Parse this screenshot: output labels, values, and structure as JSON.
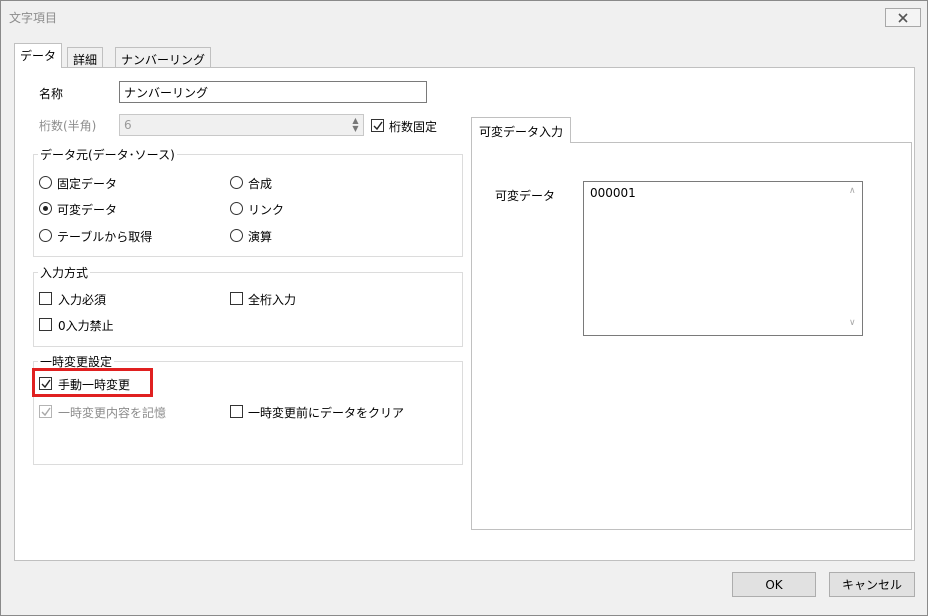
{
  "window": {
    "title": "文字項目"
  },
  "tabs": [
    {
      "label": "データ",
      "active": true
    },
    {
      "label": "詳細",
      "active": false
    },
    {
      "label": "ナンバーリング",
      "active": false
    }
  ],
  "fields": {
    "name_label": "名称",
    "name_value": "ナンバーリング",
    "digits_label": "桁数(半角)",
    "digits_value": "6",
    "fixed_digits_label": "桁数固定",
    "fixed_digits_checked": true
  },
  "data_source": {
    "title": "データ元(データ･ソース)",
    "options": [
      {
        "label": "固定データ",
        "selected": false
      },
      {
        "label": "合成",
        "selected": false
      },
      {
        "label": "可変データ",
        "selected": true
      },
      {
        "label": "リンク",
        "selected": false
      },
      {
        "label": "テーブルから取得",
        "selected": false
      },
      {
        "label": "演算",
        "selected": false
      }
    ]
  },
  "input_method": {
    "title": "入力方式",
    "options": [
      {
        "label": "入力必須",
        "checked": false
      },
      {
        "label": "全桁入力",
        "checked": false
      },
      {
        "label": "0入力禁止",
        "checked": false
      }
    ]
  },
  "temp_change": {
    "title": "一時変更設定",
    "options": [
      {
        "label": "手動一時変更",
        "checked": true,
        "enabled": true
      },
      {
        "label": "一時変更内容を記憶",
        "checked": true,
        "enabled": false
      },
      {
        "label": "一時変更前にデータをクリア",
        "checked": false,
        "enabled": true
      }
    ]
  },
  "variable_panel": {
    "tab_label": "可変データ入力",
    "field_label": "可変データ",
    "field_value": "000001"
  },
  "buttons": {
    "ok": "OK",
    "cancel": "キャンセル"
  },
  "colors": {
    "highlight": "#e02020"
  }
}
